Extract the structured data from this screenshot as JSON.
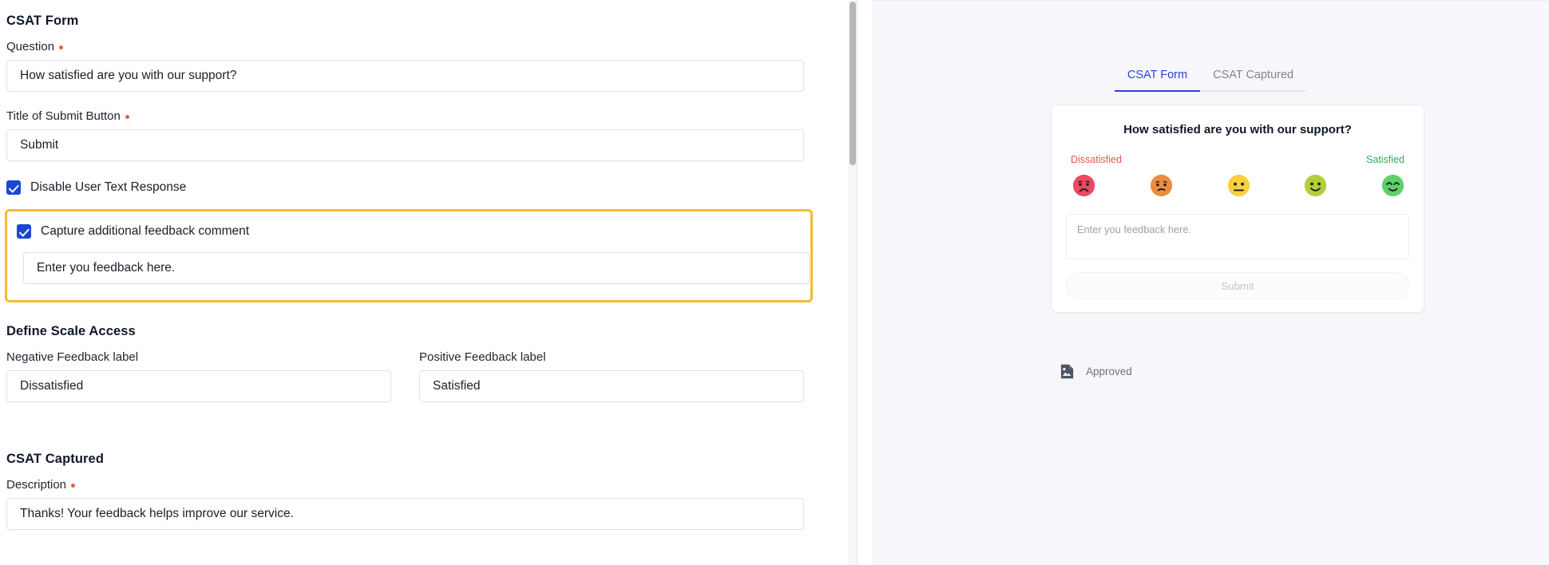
{
  "editor": {
    "csat_form": {
      "section_title": "CSAT Form",
      "question_label": "Question",
      "question_value": "How satisfied are you with our support?",
      "submit_title_label": "Title of Submit Button",
      "submit_title_value": "Submit",
      "disable_text_response_label": "Disable User Text Response",
      "capture_feedback_label": "Capture additional feedback comment",
      "feedback_placeholder_value": "Enter you feedback here."
    },
    "define_scale": {
      "section_title": "Define Scale Access",
      "negative_label": "Negative Feedback label",
      "negative_value": "Dissatisfied",
      "positive_label": "Positive Feedback label",
      "positive_value": "Satisfied"
    },
    "csat_captured": {
      "section_title": "CSAT Captured",
      "description_label": "Description",
      "description_value": "Thanks! Your feedback helps improve our service."
    }
  },
  "preview": {
    "tabs": [
      {
        "label": "CSAT Form",
        "active": true
      },
      {
        "label": "CSAT Captured",
        "active": false
      }
    ],
    "card": {
      "question": "How satisfied are you with our support?",
      "negative_label": "Dissatisfied",
      "positive_label": "Satisfied",
      "feedback_placeholder": "Enter you feedback here.",
      "submit_label": "Submit",
      "faces": [
        {
          "name": "face-very-dissatisfied",
          "color": "#e84a5f",
          "mood": "sad"
        },
        {
          "name": "face-dissatisfied",
          "color": "#ef8b3c",
          "mood": "slightly-sad"
        },
        {
          "name": "face-neutral",
          "color": "#f7cf3f",
          "mood": "neutral"
        },
        {
          "name": "face-satisfied",
          "color": "#b0cf3a",
          "mood": "happy"
        },
        {
          "name": "face-very-satisfied",
          "color": "#5fd06a",
          "mood": "very-happy"
        }
      ]
    },
    "status": {
      "label": "Approved",
      "icon": "image-document-icon"
    }
  },
  "colors": {
    "checkbox_blue": "#1a46d4",
    "highlight_amber": "#f5b938",
    "tab_active_blue": "#2a43d8",
    "required_red": "#e8603c",
    "negative_red": "#e8594a",
    "positive_green": "#2faa5d"
  }
}
